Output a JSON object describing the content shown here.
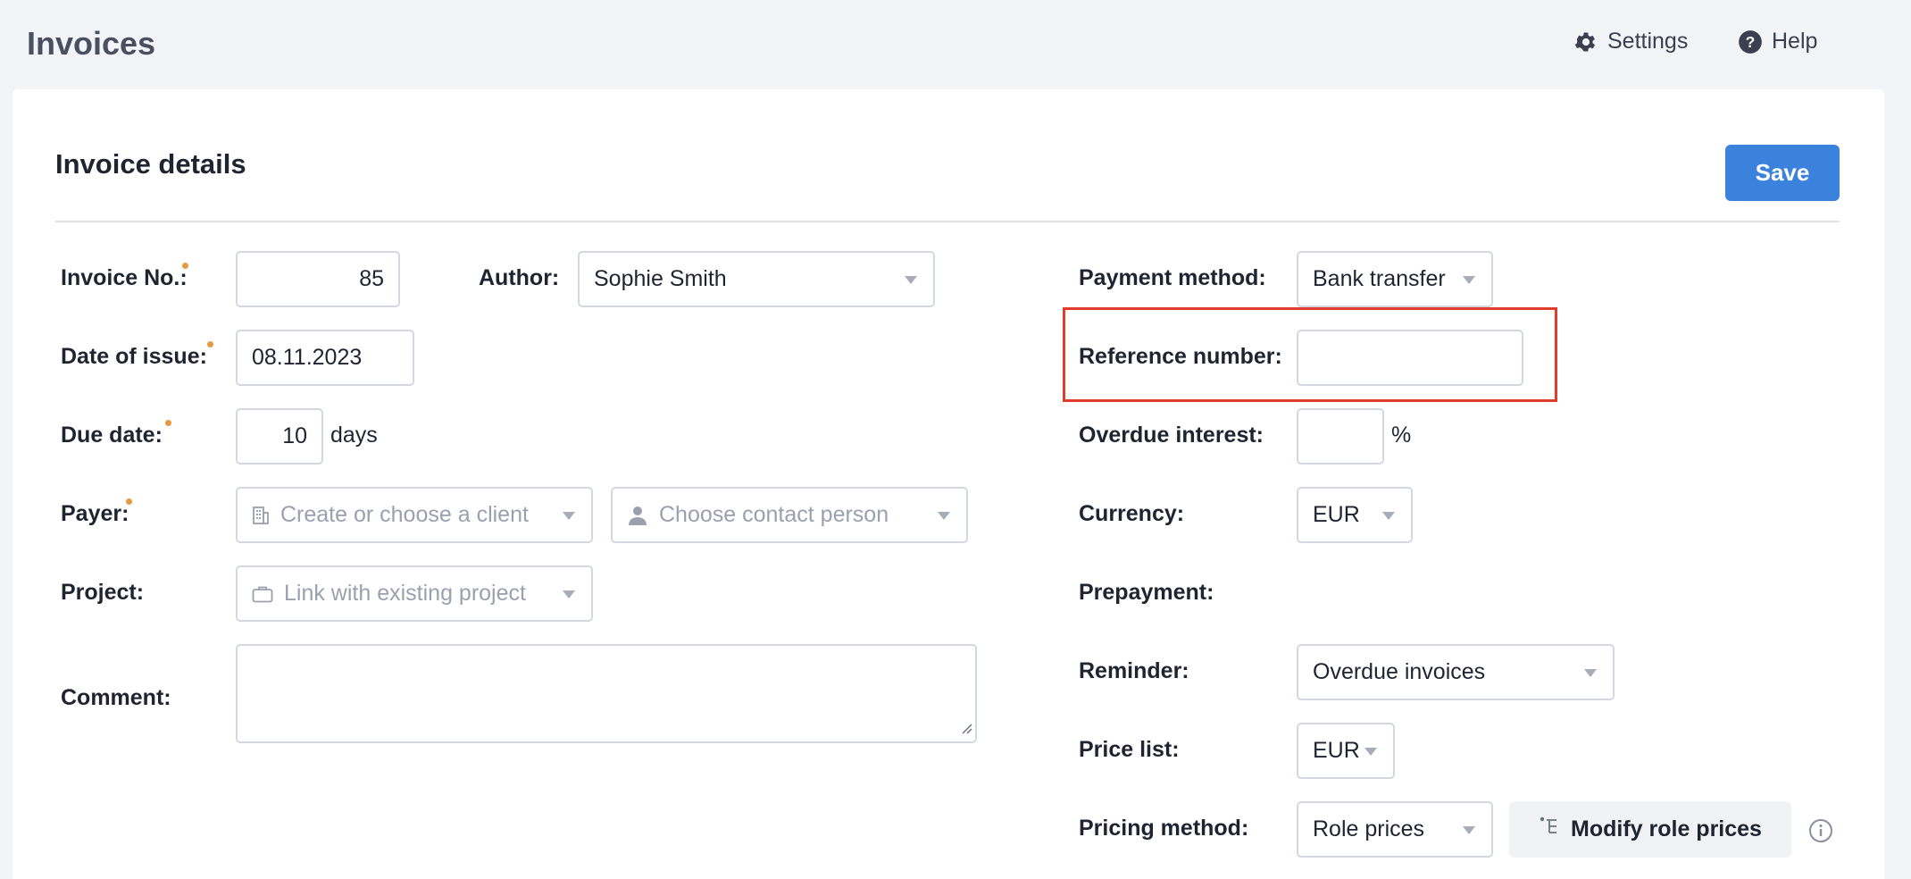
{
  "header": {
    "title": "Invoices",
    "settings_label": "Settings",
    "help_label": "Help"
  },
  "section": {
    "title": "Invoice details",
    "save_label": "Save"
  },
  "left": {
    "invoice_no": {
      "label": "Invoice No.:",
      "value": "85"
    },
    "author": {
      "label": "Author:",
      "value": "Sophie Smith"
    },
    "date_of_issue": {
      "label": "Date of issue:",
      "value": "08.11.2023"
    },
    "due_date": {
      "label": "Due date:",
      "value": "10",
      "suffix": "days"
    },
    "payer": {
      "label": "Payer:",
      "client_placeholder": "Create or choose a client",
      "contact_placeholder": "Choose contact person"
    },
    "project": {
      "label": "Project:",
      "placeholder": "Link with existing project"
    },
    "comment": {
      "label": "Comment:",
      "value": ""
    }
  },
  "right": {
    "payment_method": {
      "label": "Payment method:",
      "value": "Bank transfer"
    },
    "reference_number": {
      "label": "Reference number:",
      "value": ""
    },
    "overdue_interest": {
      "label": "Overdue interest:",
      "value": "",
      "suffix": "%"
    },
    "currency": {
      "label": "Currency:",
      "value": "EUR"
    },
    "prepayment": {
      "label": "Prepayment:"
    },
    "reminder": {
      "label": "Reminder:",
      "value": "Overdue invoices"
    },
    "price_list": {
      "label": "Price list:",
      "value": "EUR"
    },
    "pricing_method": {
      "label": "Pricing method:",
      "value": "Role prices",
      "modify_label": "Modify role prices"
    }
  },
  "colors": {
    "accent": "#3b82dd",
    "required_dot": "#e69a40",
    "highlight": "#e03c2c"
  }
}
